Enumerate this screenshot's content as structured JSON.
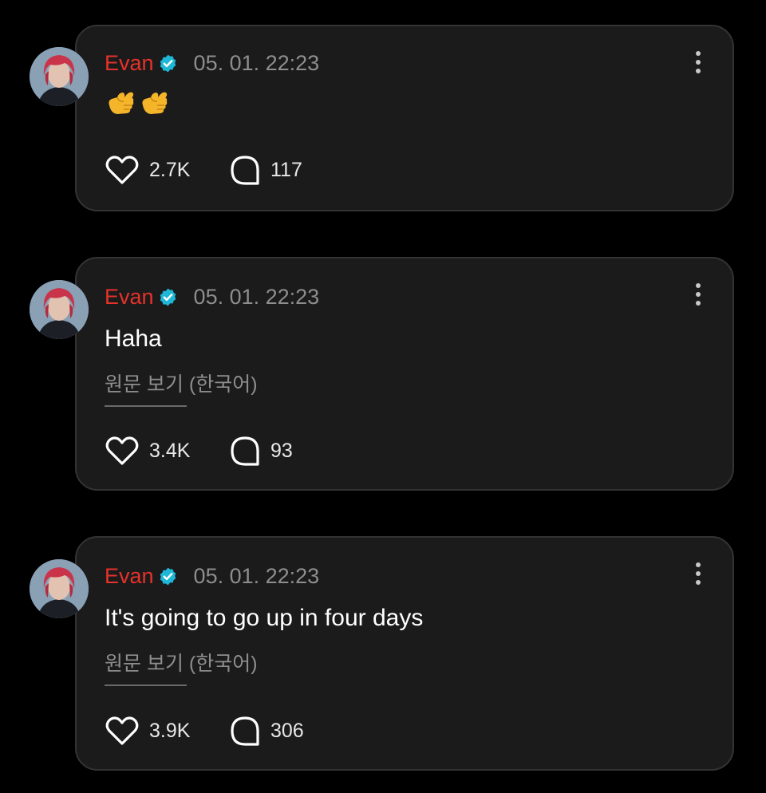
{
  "colors": {
    "background": "#000000",
    "card": "#1b1b1b",
    "card_border": "#333333",
    "author": "#e5322b",
    "verified": "#1fb7d6",
    "muted": "#8e8e8e"
  },
  "posts": [
    {
      "author": "Evan",
      "verified": true,
      "timestamp": "05. 01. 22:23",
      "emoji": [
        "🤙",
        "🤙"
      ],
      "likes": "2.7K",
      "comments": "117"
    },
    {
      "author": "Evan",
      "verified": true,
      "timestamp": "05. 01. 22:23",
      "text": "Haha",
      "translate_label": "원문 보기 (한국어)",
      "likes": "3.4K",
      "comments": "93"
    },
    {
      "author": "Evan",
      "verified": true,
      "timestamp": "05. 01. 22:23",
      "text": "It's going to go up in four days",
      "translate_label": "원문 보기 (한국어)",
      "likes": "3.9K",
      "comments": "306"
    }
  ],
  "icons": {
    "like": "heart-outline-icon",
    "comment": "speech-bubble-icon",
    "more": "vertical-ellipsis-icon",
    "verified": "verified-badge-icon"
  }
}
